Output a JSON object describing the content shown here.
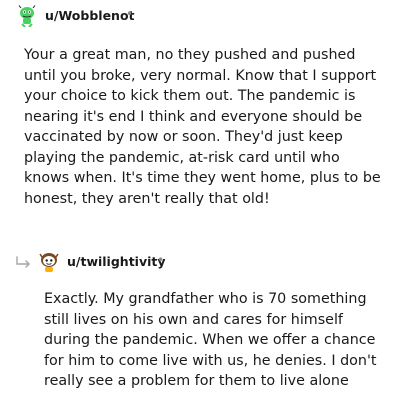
{
  "comments": [
    {
      "username": "u/Wobblenot",
      "separator": "•",
      "avatar_icon": "snoo-avatar-icon",
      "text": "Your a great man, no they pushed and pushed until you broke, very normal. Know that I support your choice to kick them out. The pandemic is nearing it's end I think and everyone should be vaccinated by now or soon. They'd just keep playing the pandemic, at-risk card until who knows when. It's time they went home, plus to be honest, they aren't really that old!"
    },
    {
      "username": "u/twilightivity",
      "separator": "•",
      "avatar_icon": "snoo-avatar-icon",
      "reply_icon": "reply-arrow-icon",
      "text": "Exactly. My grandfather who is 70 something still lives on his own and cares for himself during the pandemic. When we offer a chance for him to come live with us, he denies. I don't really see a problem for them to live alone"
    }
  ]
}
